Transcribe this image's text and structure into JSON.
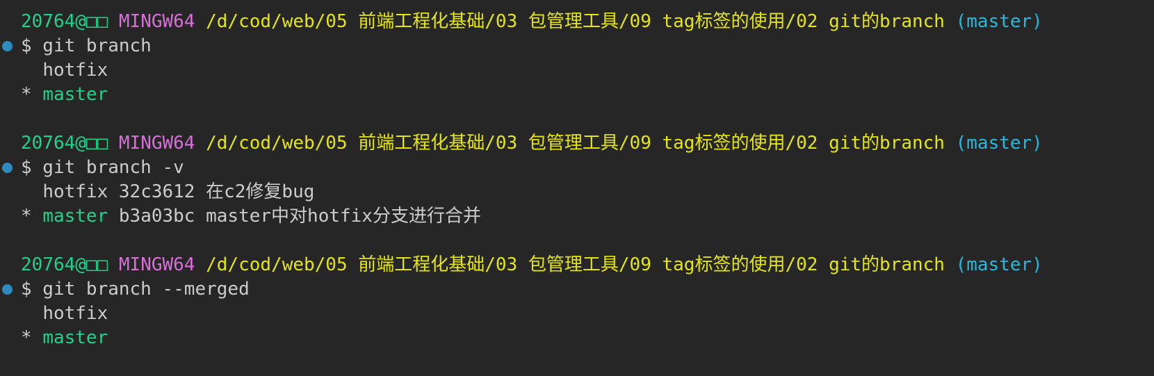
{
  "theme": {
    "bg": "#262626",
    "fg": "#cccccc",
    "green": "#23d18b",
    "magenta": "#d670d6",
    "yellow": "#e5e510",
    "cyan": "#29b8db",
    "dot": "#2e8bc0"
  },
  "prompt": {
    "user": "20764@□□",
    "system": "MINGW64",
    "path": "/d/cod/web/05 前端工程化基础/03 包管理工具/09 tag标签的使用/02 git的branch",
    "branch": "(master)"
  },
  "blocks": [
    {
      "command": "$ git branch",
      "output": [
        {
          "marker": " ",
          "name": "hotfix",
          "current": false,
          "rest": ""
        },
        {
          "marker": "*",
          "name": "master",
          "current": true,
          "rest": ""
        }
      ]
    },
    {
      "command": "$ git branch -v",
      "output": [
        {
          "marker": " ",
          "name": "hotfix",
          "current": false,
          "rest": " 32c3612 在c2修复bug"
        },
        {
          "marker": "*",
          "name": "master",
          "current": true,
          "rest": " b3a03bc master中对hotfix分支进行合并"
        }
      ]
    },
    {
      "command": "$ git branch --merged",
      "output": [
        {
          "marker": " ",
          "name": "hotfix",
          "current": false,
          "rest": ""
        },
        {
          "marker": "*",
          "name": "master",
          "current": true,
          "rest": ""
        }
      ]
    }
  ]
}
